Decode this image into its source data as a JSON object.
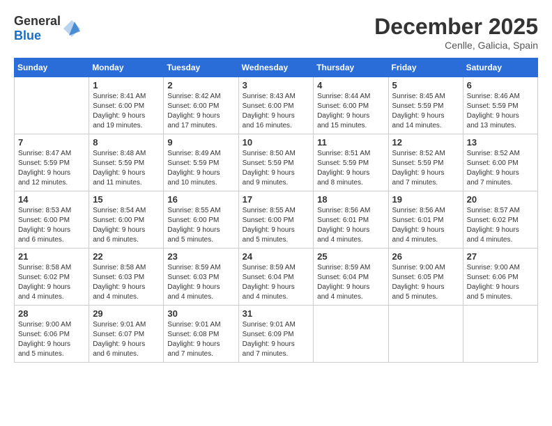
{
  "header": {
    "logo_general": "General",
    "logo_blue": "Blue",
    "month": "December 2025",
    "location": "Cenlle, Galicia, Spain"
  },
  "weekdays": [
    "Sunday",
    "Monday",
    "Tuesday",
    "Wednesday",
    "Thursday",
    "Friday",
    "Saturday"
  ],
  "weeks": [
    [
      {
        "day": "",
        "info": ""
      },
      {
        "day": "1",
        "info": "Sunrise: 8:41 AM\nSunset: 6:00 PM\nDaylight: 9 hours\nand 19 minutes."
      },
      {
        "day": "2",
        "info": "Sunrise: 8:42 AM\nSunset: 6:00 PM\nDaylight: 9 hours\nand 17 minutes."
      },
      {
        "day": "3",
        "info": "Sunrise: 8:43 AM\nSunset: 6:00 PM\nDaylight: 9 hours\nand 16 minutes."
      },
      {
        "day": "4",
        "info": "Sunrise: 8:44 AM\nSunset: 6:00 PM\nDaylight: 9 hours\nand 15 minutes."
      },
      {
        "day": "5",
        "info": "Sunrise: 8:45 AM\nSunset: 5:59 PM\nDaylight: 9 hours\nand 14 minutes."
      },
      {
        "day": "6",
        "info": "Sunrise: 8:46 AM\nSunset: 5:59 PM\nDaylight: 9 hours\nand 13 minutes."
      }
    ],
    [
      {
        "day": "7",
        "info": "Sunrise: 8:47 AM\nSunset: 5:59 PM\nDaylight: 9 hours\nand 12 minutes."
      },
      {
        "day": "8",
        "info": "Sunrise: 8:48 AM\nSunset: 5:59 PM\nDaylight: 9 hours\nand 11 minutes."
      },
      {
        "day": "9",
        "info": "Sunrise: 8:49 AM\nSunset: 5:59 PM\nDaylight: 9 hours\nand 10 minutes."
      },
      {
        "day": "10",
        "info": "Sunrise: 8:50 AM\nSunset: 5:59 PM\nDaylight: 9 hours\nand 9 minutes."
      },
      {
        "day": "11",
        "info": "Sunrise: 8:51 AM\nSunset: 5:59 PM\nDaylight: 9 hours\nand 8 minutes."
      },
      {
        "day": "12",
        "info": "Sunrise: 8:52 AM\nSunset: 5:59 PM\nDaylight: 9 hours\nand 7 minutes."
      },
      {
        "day": "13",
        "info": "Sunrise: 8:52 AM\nSunset: 6:00 PM\nDaylight: 9 hours\nand 7 minutes."
      }
    ],
    [
      {
        "day": "14",
        "info": "Sunrise: 8:53 AM\nSunset: 6:00 PM\nDaylight: 9 hours\nand 6 minutes."
      },
      {
        "day": "15",
        "info": "Sunrise: 8:54 AM\nSunset: 6:00 PM\nDaylight: 9 hours\nand 6 minutes."
      },
      {
        "day": "16",
        "info": "Sunrise: 8:55 AM\nSunset: 6:00 PM\nDaylight: 9 hours\nand 5 minutes."
      },
      {
        "day": "17",
        "info": "Sunrise: 8:55 AM\nSunset: 6:00 PM\nDaylight: 9 hours\nand 5 minutes."
      },
      {
        "day": "18",
        "info": "Sunrise: 8:56 AM\nSunset: 6:01 PM\nDaylight: 9 hours\nand 4 minutes."
      },
      {
        "day": "19",
        "info": "Sunrise: 8:56 AM\nSunset: 6:01 PM\nDaylight: 9 hours\nand 4 minutes."
      },
      {
        "day": "20",
        "info": "Sunrise: 8:57 AM\nSunset: 6:02 PM\nDaylight: 9 hours\nand 4 minutes."
      }
    ],
    [
      {
        "day": "21",
        "info": "Sunrise: 8:58 AM\nSunset: 6:02 PM\nDaylight: 9 hours\nand 4 minutes."
      },
      {
        "day": "22",
        "info": "Sunrise: 8:58 AM\nSunset: 6:03 PM\nDaylight: 9 hours\nand 4 minutes."
      },
      {
        "day": "23",
        "info": "Sunrise: 8:59 AM\nSunset: 6:03 PM\nDaylight: 9 hours\nand 4 minutes."
      },
      {
        "day": "24",
        "info": "Sunrise: 8:59 AM\nSunset: 6:04 PM\nDaylight: 9 hours\nand 4 minutes."
      },
      {
        "day": "25",
        "info": "Sunrise: 8:59 AM\nSunset: 6:04 PM\nDaylight: 9 hours\nand 4 minutes."
      },
      {
        "day": "26",
        "info": "Sunrise: 9:00 AM\nSunset: 6:05 PM\nDaylight: 9 hours\nand 5 minutes."
      },
      {
        "day": "27",
        "info": "Sunrise: 9:00 AM\nSunset: 6:06 PM\nDaylight: 9 hours\nand 5 minutes."
      }
    ],
    [
      {
        "day": "28",
        "info": "Sunrise: 9:00 AM\nSunset: 6:06 PM\nDaylight: 9 hours\nand 5 minutes."
      },
      {
        "day": "29",
        "info": "Sunrise: 9:01 AM\nSunset: 6:07 PM\nDaylight: 9 hours\nand 6 minutes."
      },
      {
        "day": "30",
        "info": "Sunrise: 9:01 AM\nSunset: 6:08 PM\nDaylight: 9 hours\nand 7 minutes."
      },
      {
        "day": "31",
        "info": "Sunrise: 9:01 AM\nSunset: 6:09 PM\nDaylight: 9 hours\nand 7 minutes."
      },
      {
        "day": "",
        "info": ""
      },
      {
        "day": "",
        "info": ""
      },
      {
        "day": "",
        "info": ""
      }
    ]
  ]
}
